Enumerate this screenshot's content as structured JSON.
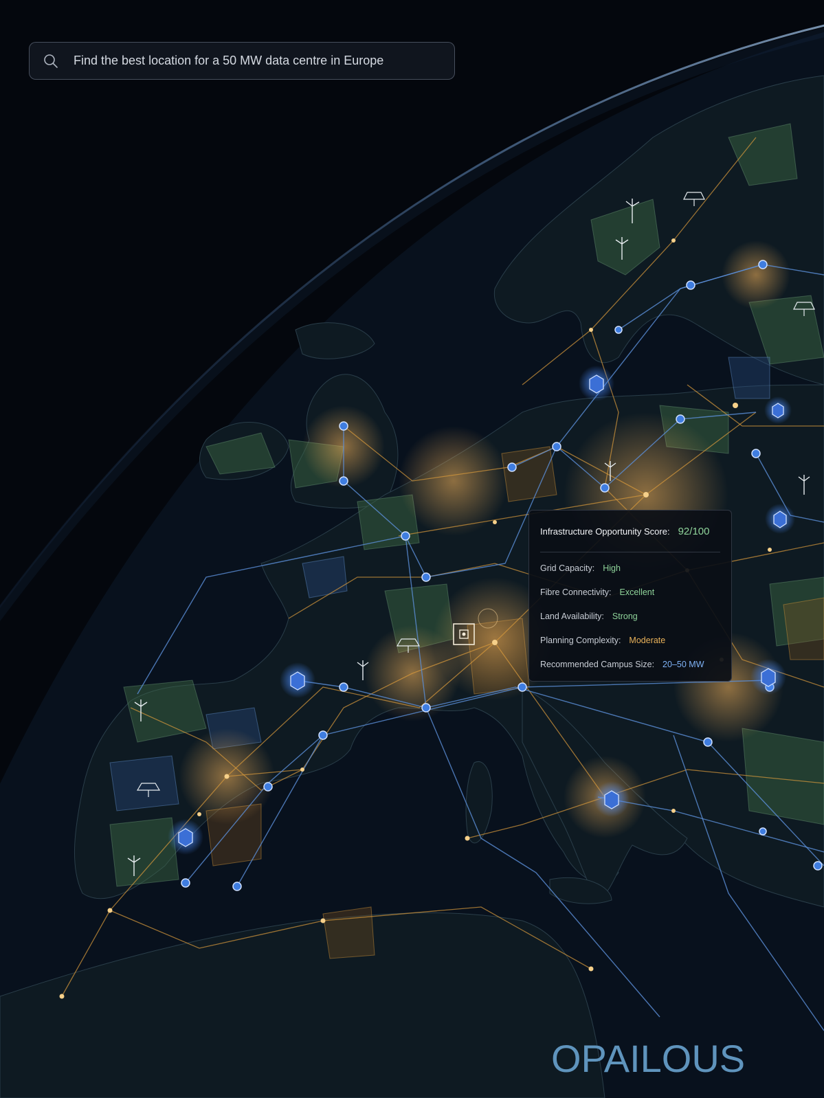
{
  "search": {
    "value": "Find the best location for a 50 MW data centre in Europe",
    "icon": "search-icon"
  },
  "score_card": {
    "title": "Infrastructure Opportunity Score:",
    "score": "92/100",
    "metrics": [
      {
        "label": "Grid Capacity:",
        "value": "High",
        "color": "#8fd39a"
      },
      {
        "label": "Fibre Connectivity:",
        "value": "Excellent",
        "color": "#8fd39a"
      },
      {
        "label": "Land Availability:",
        "value": "Strong",
        "color": "#8fd39a"
      },
      {
        "label": "Planning Complexity:",
        "value": "Moderate",
        "color": "#e9b25a"
      },
      {
        "label": "Recommended Campus Size:",
        "value": "20–50 MW",
        "color": "#7fb2f5"
      }
    ]
  },
  "brand": {
    "name": "OPAILOUS",
    "color": "#5f94bd"
  },
  "map": {
    "icons": [
      "data-centre-icon",
      "wind-turbine-icon",
      "solar-panel-icon",
      "target-marker-icon",
      "network-node-icon"
    ],
    "colors": {
      "power_line": "#d89a3c",
      "fibre_line": "#5b8fd8",
      "node": "#3f7de0",
      "city_light": "#f2c06a",
      "region": "#3f6b45"
    }
  }
}
